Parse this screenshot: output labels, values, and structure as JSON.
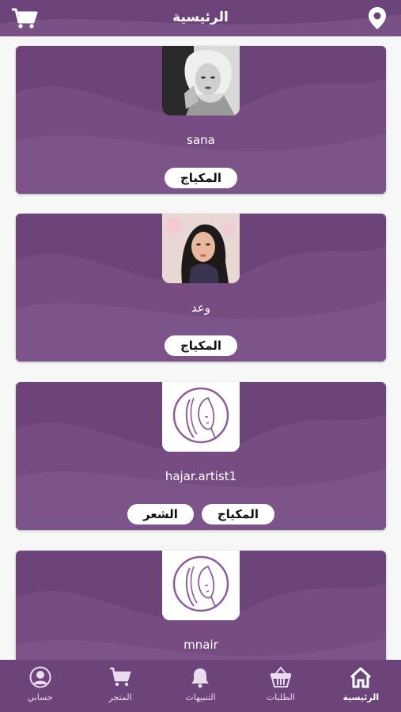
{
  "header": {
    "title": "الرئيسية"
  },
  "artists": [
    {
      "name": "sana",
      "tags": [
        "المكياج"
      ]
    },
    {
      "name": "وعد",
      "tags": [
        "المكياج"
      ]
    },
    {
      "name": "hajar.artist1",
      "tags": [
        "المكياج",
        "الشعر"
      ]
    },
    {
      "name": "mnair",
      "tags": []
    }
  ],
  "bottom_nav": {
    "items": [
      {
        "label": "الرئيسية",
        "icon": "home-icon",
        "active": true
      },
      {
        "label": "الطلبات",
        "icon": "basket-icon"
      },
      {
        "label": "التنبيهات",
        "icon": "bell-icon"
      },
      {
        "label": "المتجر",
        "icon": "cart-icon"
      },
      {
        "label": "حسابي",
        "icon": "user-icon"
      }
    ]
  },
  "colors": {
    "primary": "#6d4479",
    "wave": "#7a5187",
    "white": "#ffffff"
  }
}
